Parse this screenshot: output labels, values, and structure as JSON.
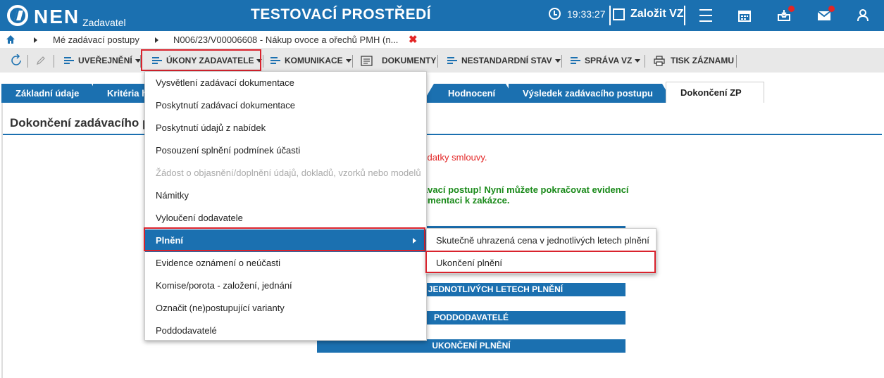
{
  "header": {
    "logo_text": "NEN",
    "logo_sub": "Zadavatel",
    "env_title": "TESTOVACÍ PROSTŘEDÍ",
    "clock": "19:33:27",
    "create_vz": "Založit VZ"
  },
  "breadcrumb": {
    "item1": "Mé zadávací postupy",
    "item2": "N006/23/V00006608 - Nákup ovoce a ořechů PMH (n...",
    "close": "✖"
  },
  "toolbar": {
    "uverejneni": "UVEŘEJNĚNÍ",
    "ukony": "ÚKONY ZADAVATELE",
    "komunikace": "KOMUNIKACE",
    "dokumenty": "DOKUMENTY",
    "nestandardni": "NESTANDARDNÍ STAV",
    "sprava": "SPRÁVA VZ",
    "tisk": "TISK ZÁZNAMU"
  },
  "tabs": {
    "t1": "Základní údaje",
    "t2": "Kritéria h",
    "t3": "Hodnocení",
    "t4": "Výsledek zadávacího postupu",
    "t5": "Dokončení ZP"
  },
  "content": {
    "section_title": "Dokončení zadávacího p",
    "msg_red": "dodatky smlouvy.",
    "msg_green_1": "dávací postup! Nyní můžete pokračovat evidencí",
    "msg_green_2": "kumentaci k zakázce.",
    "bar1": "",
    "bar2": "NÁ CENA V JEDNOTLIVÝCH LETECH PLNĚNÍ",
    "bar3": "PODDODAVATELÉ",
    "bar4": "UKONČENÍ PLNĚNÍ"
  },
  "dropdown": {
    "items": [
      "Vysvětlení zadávací dokumentace",
      "Poskytnutí zadávací dokumentace",
      "Poskytnutí údajů z nabídek",
      "Posouzení splnění podmínek účasti",
      "Žádost o objasnění/doplnění údajů, dokladů, vzorků nebo modelů",
      "Námitky",
      "Vyloučení dodavatele",
      "Plnění",
      "Evidence oznámení o neúčasti",
      "Komise/porota - založení, jednání",
      "Označit (ne)postupující varianty",
      "Poddodavatelé"
    ]
  },
  "submenu": {
    "items": [
      "Skutečně uhrazená cena v jednotlivých letech plnění",
      "Ukončení plnění"
    ]
  },
  "colors": {
    "brand_blue": "#1b70b0",
    "highlight_red": "#d9232d",
    "success_green": "#1a8a1a",
    "error_red": "#e32626"
  }
}
